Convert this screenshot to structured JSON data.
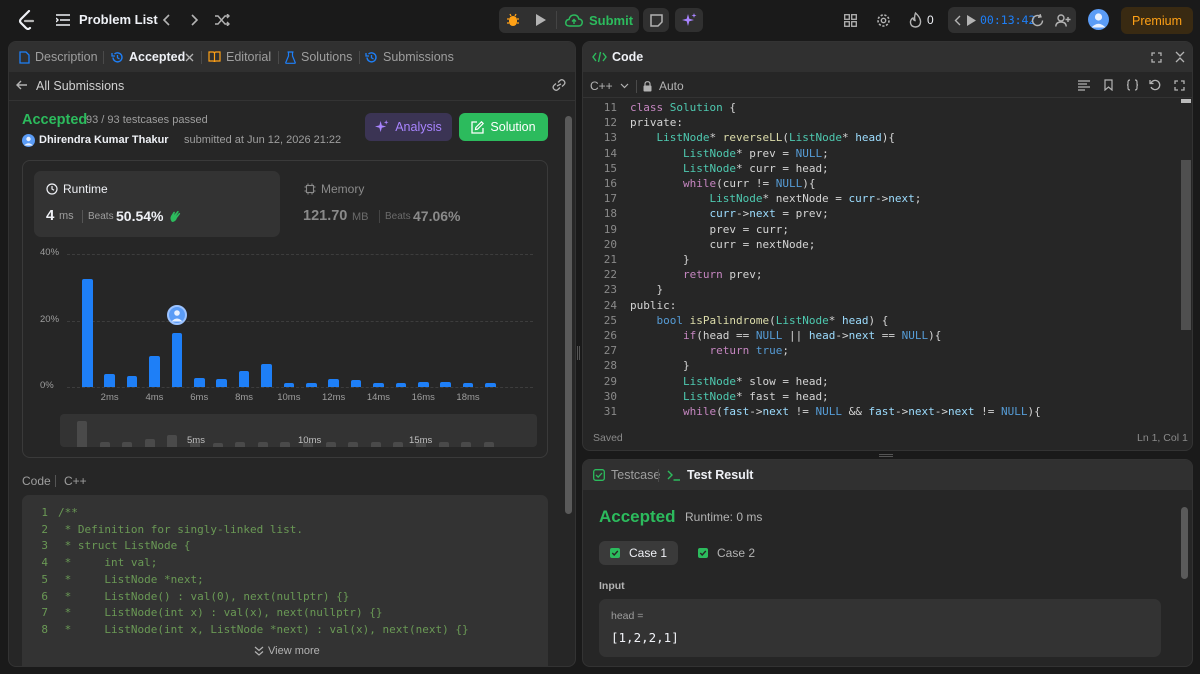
{
  "topbar": {
    "problem_list": "Problem List",
    "submit": "Submit",
    "streak": "0",
    "timer": "00:13:42",
    "premium": "Premium"
  },
  "left_tabs": {
    "description": "Description",
    "accepted": "Accepted",
    "editorial": "Editorial",
    "solutions": "Solutions",
    "submissions": "Submissions"
  },
  "submission": {
    "back_label": "All Submissions",
    "status": "Accepted",
    "testcases": "93 / 93 testcases passed",
    "user": "Dhirendra Kumar Thakur",
    "submitted_at": "submitted at Jun 12, 2026 21:22",
    "analysis": "Analysis",
    "solution": "Solution"
  },
  "stats": {
    "runtime_label": "Runtime",
    "runtime_value": "4",
    "runtime_unit": "ms",
    "beats_label": "Beats",
    "runtime_beats": "50.54%",
    "memory_label": "Memory",
    "memory_value": "121.70",
    "memory_unit": "MB",
    "memory_beats": "47.06%"
  },
  "chart_data": {
    "type": "bar",
    "y_ticks": [
      "40%",
      "20%",
      "0%"
    ],
    "ylim": [
      0,
      40
    ],
    "x_ticks": [
      "2ms",
      "4ms",
      "6ms",
      "8ms",
      "10ms",
      "12ms",
      "14ms",
      "16ms",
      "18ms"
    ],
    "categories": [
      "1ms",
      "2ms",
      "3ms",
      "4ms",
      "5ms",
      "6ms",
      "7ms",
      "8ms",
      "9ms",
      "10ms",
      "11ms",
      "12ms",
      "13ms",
      "14ms",
      "15ms",
      "16ms",
      "17ms",
      "18ms",
      "19ms"
    ],
    "values": [
      32.5,
      4,
      3.3,
      9.3,
      16.3,
      2.8,
      2.3,
      4.8,
      7,
      1.3,
      1.3,
      2.3,
      2,
      1.3,
      1.3,
      1.6,
      1.6,
      1.3,
      1.3
    ],
    "highlight_index": 4,
    "minimap_ticks": [
      "5ms",
      "10ms",
      "15ms"
    ],
    "minimap_values": [
      26,
      5,
      5,
      8,
      12,
      5,
      4,
      5,
      5,
      5,
      5,
      5,
      5,
      5,
      5,
      5,
      5,
      5,
      5
    ]
  },
  "code_section": {
    "label": "Code",
    "lang": "C++",
    "view_more": "View more",
    "lines": [
      "/**",
      " * Definition for singly-linked list.",
      " * struct ListNode {",
      " *     int val;",
      " *     ListNode *next;",
      " *     ListNode() : val(0), next(nullptr) {}",
      " *     ListNode(int x) : val(x), next(nullptr) {}",
      " *     ListNode(int x, ListNode *next) : val(x), next(next) {}"
    ]
  },
  "editor": {
    "title": "Code",
    "lang": "C++",
    "mode": "Auto",
    "status_saved": "Saved",
    "cursor": "Ln 1, Col 1",
    "start_line": 11,
    "lines": [
      [
        [
          "class ",
          "k"
        ],
        [
          "Solution",
          "t"
        ],
        [
          " {",
          ""
        ]
      ],
      [
        [
          "private",
          ""
        ],
        [
          ":",
          ""
        ]
      ],
      [
        [
          "    ListNode",
          "t"
        ],
        [
          "* ",
          ""
        ],
        [
          "reverseLL",
          "f"
        ],
        [
          "(",
          ""
        ],
        [
          "ListNode",
          "t"
        ],
        [
          "* ",
          ""
        ],
        [
          "head",
          "v"
        ],
        [
          "){",
          ""
        ]
      ],
      [
        [
          "        ListNode",
          "t"
        ],
        [
          "* prev = ",
          ""
        ],
        [
          "NULL",
          "n"
        ],
        [
          ";",
          ""
        ]
      ],
      [
        [
          "        ListNode",
          "t"
        ],
        [
          "* curr = head;",
          ""
        ]
      ],
      [
        [
          "        while",
          "k"
        ],
        [
          "(curr != ",
          ""
        ],
        [
          "NULL",
          "n"
        ],
        [
          "){",
          ""
        ]
      ],
      [
        [
          "            ListNode",
          "t"
        ],
        [
          "* nextNode = ",
          ""
        ],
        [
          "curr",
          "v"
        ],
        [
          "->",
          ""
        ],
        [
          "next",
          "v"
        ],
        [
          ";",
          ""
        ]
      ],
      [
        [
          "            ",
          ""
        ],
        [
          "curr",
          "v"
        ],
        [
          "->",
          ""
        ],
        [
          "next",
          "v"
        ],
        [
          " = prev;",
          ""
        ]
      ],
      [
        [
          "            prev = curr;",
          ""
        ]
      ],
      [
        [
          "            curr = nextNode;",
          ""
        ]
      ],
      [
        [
          "        }",
          ""
        ]
      ],
      [
        [
          "        return",
          "k"
        ],
        [
          " prev;",
          ""
        ]
      ],
      [
        [
          "    }",
          ""
        ]
      ],
      [
        [
          "public",
          ""
        ],
        [
          ":",
          ""
        ]
      ],
      [
        [
          "    bool ",
          "kb"
        ],
        [
          "isPalindrome",
          "f"
        ],
        [
          "(",
          ""
        ],
        [
          "ListNode",
          "t"
        ],
        [
          "* ",
          ""
        ],
        [
          "head",
          "v"
        ],
        [
          ") {",
          ""
        ]
      ],
      [
        [
          "        if",
          "k"
        ],
        [
          "(head == ",
          ""
        ],
        [
          "NULL",
          "n"
        ],
        [
          " || ",
          ""
        ],
        [
          "head",
          "v"
        ],
        [
          "->",
          ""
        ],
        [
          "next",
          "v"
        ],
        [
          " == ",
          ""
        ],
        [
          "NULL",
          "n"
        ],
        [
          "){",
          ""
        ]
      ],
      [
        [
          "            return ",
          "k"
        ],
        [
          "true",
          "n"
        ],
        [
          ";",
          ""
        ]
      ],
      [
        [
          "        }",
          ""
        ]
      ],
      [
        [
          "        ListNode",
          "t"
        ],
        [
          "* slow = head;",
          ""
        ]
      ],
      [
        [
          "        ListNode",
          "t"
        ],
        [
          "* fast = head;",
          ""
        ]
      ],
      [
        [
          "        while",
          "k"
        ],
        [
          "(",
          ""
        ],
        [
          "fast",
          "v"
        ],
        [
          "->",
          ""
        ],
        [
          "next",
          "v"
        ],
        [
          " != ",
          ""
        ],
        [
          "NULL",
          "n"
        ],
        [
          " && ",
          ""
        ],
        [
          "fast",
          "v"
        ],
        [
          "->",
          ""
        ],
        [
          "next",
          "v"
        ],
        [
          "->",
          ""
        ],
        [
          "next",
          "v"
        ],
        [
          " != ",
          ""
        ],
        [
          "NULL",
          "n"
        ],
        [
          "){",
          ""
        ]
      ]
    ]
  },
  "bottom": {
    "testcase_tab": "Testcase",
    "result_tab": "Test Result",
    "status": "Accepted",
    "runtime": "Runtime: 0 ms",
    "case1": "Case 1",
    "case2": "Case 2",
    "input_label": "Input",
    "var_name": "head =",
    "var_value": "[1,2,2,1]"
  },
  "colors": {
    "accent_green": "#2cbb5d",
    "accent_orange": "#ffa116",
    "bar_blue": "#1e7ff7"
  }
}
